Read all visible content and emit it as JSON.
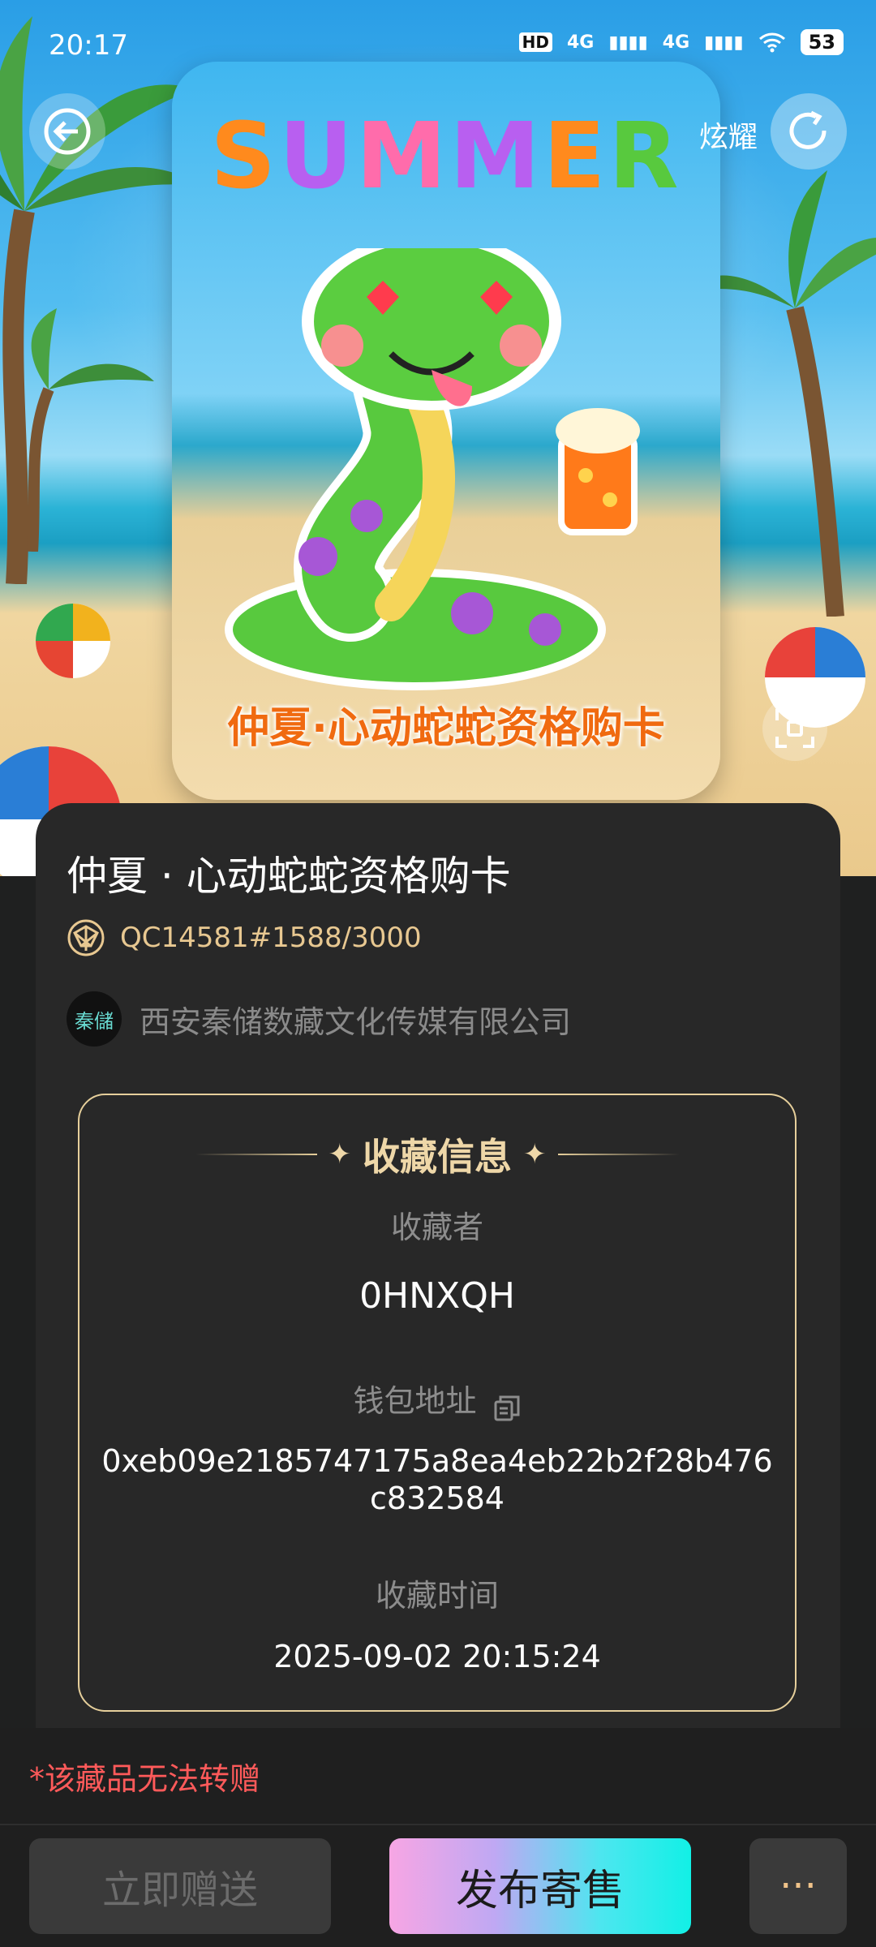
{
  "status_bar": {
    "time": "20:17",
    "network_1": "4G",
    "network_2": "4G",
    "hd_label": "HD",
    "battery": "53"
  },
  "header": {
    "share_label": "炫耀"
  },
  "card": {
    "headline": "SUMMER",
    "title_overlay": "仲夏·心动蛇蛇资格购卡"
  },
  "item": {
    "title": "仲夏 · 心动蛇蛇资格购卡",
    "serial": "QC14581#1588/3000",
    "issuer_logo_text": "秦儲",
    "issuer": "西安秦储数藏文化传媒有限公司"
  },
  "collection_info": {
    "heading": "收藏信息",
    "owner_label": "收藏者",
    "owner_value": "0HNXQH",
    "wallet_label": "钱包地址",
    "wallet_line1": "0xeb09e2185747175a8ea4eb22b2f28b476",
    "wallet_line2": "c832584",
    "time_label": "收藏时间",
    "time_value": "2025-09-02 20:15:24"
  },
  "footer": {
    "warning": "*该藏品无法转赠",
    "gift_button": "立即赠送",
    "sell_button": "发布寄售",
    "more_button": "···"
  },
  "colors": {
    "accent_gold": "#e6cf9b",
    "warning_red": "#ff5a5a",
    "panel_bg": "#282828"
  }
}
